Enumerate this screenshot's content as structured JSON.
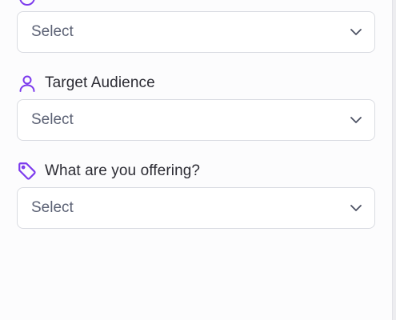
{
  "fields": [
    {
      "label": "",
      "value": "Select",
      "icon": "circle-icon",
      "accent": "#7c3aed"
    },
    {
      "label": "Target Audience",
      "value": "Select",
      "icon": "user-icon",
      "accent": "#7c3aed"
    },
    {
      "label": "What are you offering?",
      "value": "Select",
      "icon": "tag-icon",
      "accent": "#7c3aed"
    }
  ]
}
